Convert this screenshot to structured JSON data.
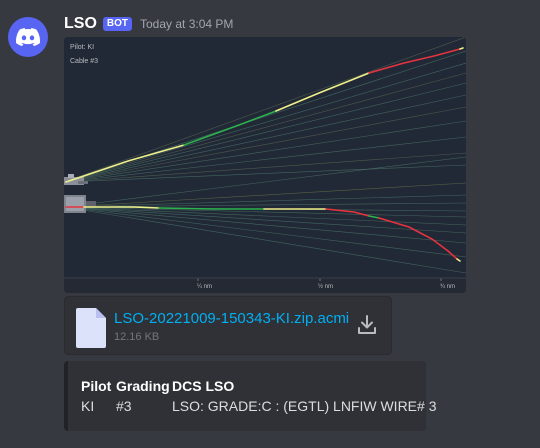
{
  "message": {
    "author": "LSO",
    "bot_tag": "BOT",
    "timestamp": "Today at 3:04 PM"
  },
  "chart_data": {
    "type": "line",
    "annotations": [
      "Pilot: KI",
      "Cable #3"
    ],
    "x_tick_labels": [
      "¼ nm",
      "½ nm",
      "¾ nm"
    ],
    "panels": [
      "glideslope",
      "lineup"
    ],
    "colors": {
      "background": "#242933",
      "on_track": "#f0f08a",
      "good": "#2bb24c",
      "deviation": "#e6333f",
      "reference_lines": "#4f7f6f"
    }
  },
  "attachment": {
    "file_name": "LSO-20221009-150343-KI.zip.acmi",
    "file_size": "12.16 KB"
  },
  "embed": {
    "fields": [
      {
        "name": "Pilot",
        "value": "KI"
      },
      {
        "name": "Grading",
        "value": "#3"
      },
      {
        "name": "DCS LSO",
        "value": "LSO: GRADE:C : (EGTL) LNFIW WIRE# 3"
      }
    ]
  }
}
